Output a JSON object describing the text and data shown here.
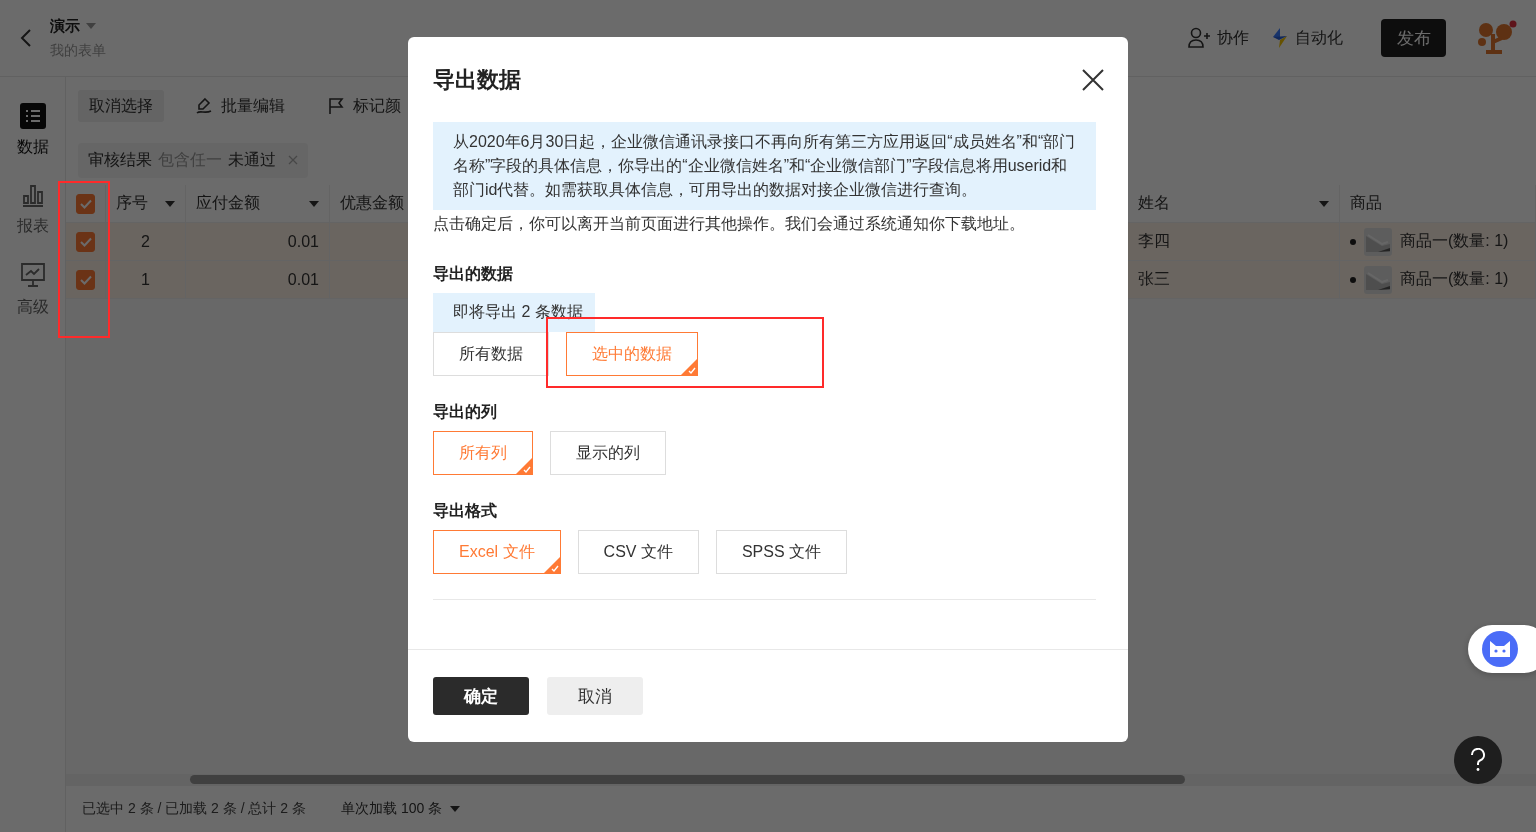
{
  "header": {
    "title": "演示",
    "subtitle": "我的表单",
    "actions": [
      {
        "kind": "collaborate",
        "label": "协作"
      },
      {
        "kind": "automation",
        "label": "自动化"
      }
    ],
    "publish": "发布"
  },
  "sidebar": {
    "items": [
      {
        "kind": "data",
        "label": "数据",
        "selected": true
      },
      {
        "kind": "report",
        "label": "报表",
        "selected": false
      },
      {
        "kind": "advanced",
        "label": "高级",
        "selected": false
      }
    ]
  },
  "toolbar": [
    {
      "kind": "cancel",
      "label": "取消选择"
    },
    {
      "kind": "edit",
      "label": "批量编辑"
    },
    {
      "kind": "flag",
      "label": "标记颜"
    }
  ],
  "filter": {
    "field": "审核结果",
    "operator": "包含任一",
    "value": "未通过"
  },
  "table": {
    "all_checked": true,
    "columns": [
      {
        "label": "序号",
        "sortable": true
      },
      {
        "label": "应付金额",
        "sortable": true
      },
      {
        "label": "优惠金额"
      },
      {
        "label": "姓名",
        "sortable": true
      },
      {
        "label": "商品",
        "sortable": false
      }
    ],
    "rows": [
      {
        "checked": true,
        "seq": "2",
        "amount": "0.01",
        "name": "李四",
        "product": "商品一(数量: 1)"
      },
      {
        "checked": true,
        "seq": "1",
        "amount": "0.01",
        "name": "张三",
        "product": "商品一(数量: 1)"
      }
    ]
  },
  "status_bar": {
    "summary": "已选中 2 条 / 已加载 2 条 / 总计 2 条",
    "page_size": "单次加载 100 条"
  },
  "dialog": {
    "title": "导出数据",
    "notice": "从2020年6月30日起，企业微信通讯录接口不再向所有第三方应用返回“成员姓名”和“部门名称”字段的具体信息，你导出的“企业微信姓名”和“企业微信部门”字段信息将用userid和部门id代替。如需获取具体信息，可用导出的数据对接企业微信进行查询。",
    "info": "点击确定后，你可以离开当前页面进行其他操作。我们会通过系统通知你下载地址。",
    "sections": [
      {
        "title": "导出的数据",
        "hint": "即将导出 2 条数据",
        "options": [
          {
            "label": "所有数据",
            "selected": false
          },
          {
            "label": "选中的数据",
            "selected": true
          }
        ]
      },
      {
        "title": "导出的列",
        "options": [
          {
            "label": "所有列",
            "selected": true
          },
          {
            "label": "显示的列",
            "selected": false
          }
        ]
      },
      {
        "title": "导出格式",
        "options": [
          {
            "label": "Excel 文件",
            "selected": true
          },
          {
            "label": "CSV 文件",
            "selected": false
          },
          {
            "label": "SPSS 文件",
            "selected": false
          }
        ]
      }
    ],
    "confirm": "确定",
    "cancel": "取消"
  }
}
